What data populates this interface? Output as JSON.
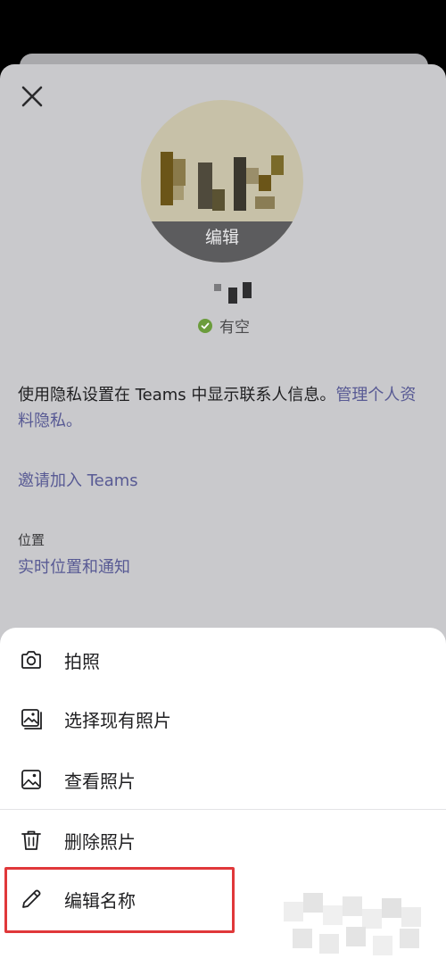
{
  "profile": {
    "avatar_edit_label": "编辑",
    "status_text": "有空",
    "privacy_text": "使用隐私设置在 Teams 中显示联系人信息。",
    "privacy_link": "管理个人资料隐私。",
    "invite_link": "邀请加入 Teams",
    "location_label": "位置",
    "location_link": "实时位置和通知"
  },
  "menu": {
    "items": [
      {
        "label": "拍照",
        "icon": "camera-icon"
      },
      {
        "label": "选择现有照片",
        "icon": "photo-library-icon"
      },
      {
        "label": "查看照片",
        "icon": "image-icon"
      },
      {
        "label": "删除照片",
        "icon": "trash-icon"
      },
      {
        "label": "编辑名称",
        "icon": "pencil-icon"
      }
    ]
  },
  "colors": {
    "overlay": "#c9c9cc",
    "link": "#585a94",
    "status_green": "#6b9c3c",
    "highlight_red": "#e0383a"
  }
}
